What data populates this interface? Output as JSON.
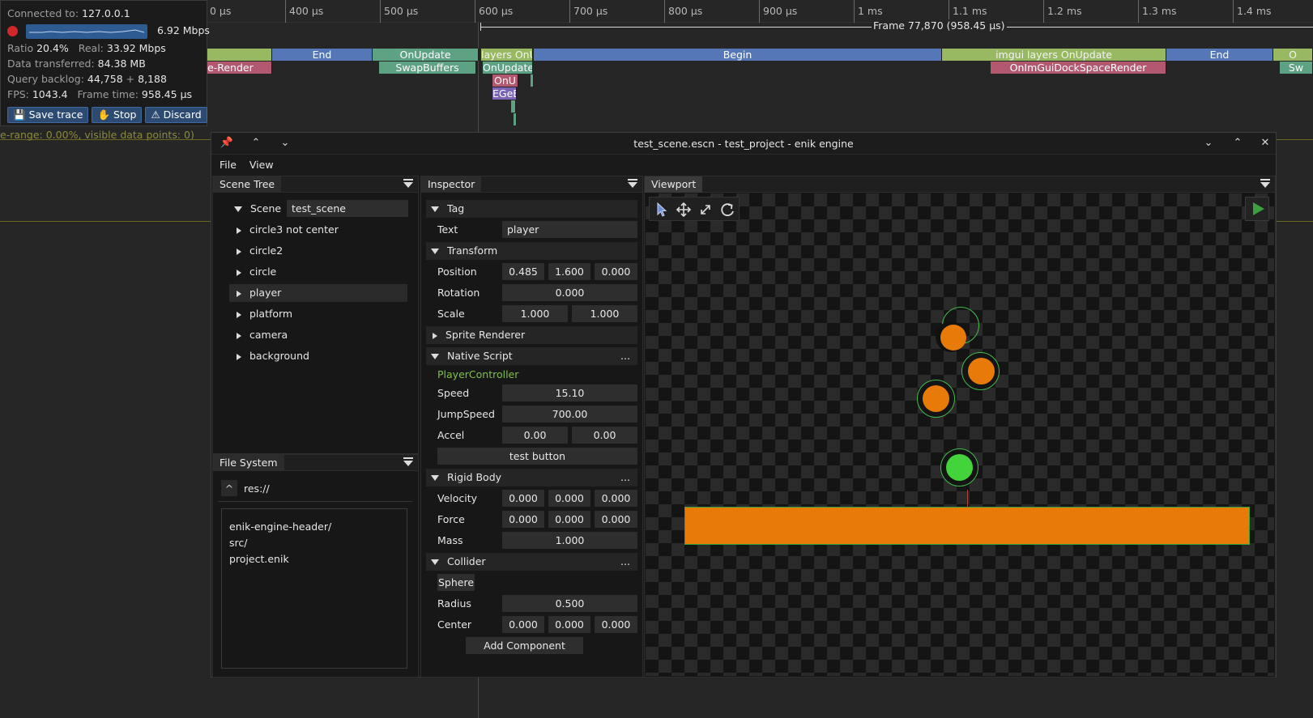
{
  "profiler": {
    "ticks": [
      "0 µs",
      "400 µs",
      "500 µs",
      "600 µs",
      "700 µs",
      "800 µs",
      "900 µs",
      "1 ms",
      "1.1 ms",
      "1.2 ms",
      "1.3 ms",
      "1.4 ms"
    ],
    "frame_label": "Frame 77,870 (958.45 µs)",
    "zones": {
      "end1": "End",
      "onupdate1": "OnUpdate",
      "render1": "e-Render",
      "swapbuffers": "SwapBuffers",
      "layers_onu": "layers OnU",
      "onupdate2": "OnUpdate",
      "begin": "Begin",
      "imgui_layers": "imgui layers OnUpdate",
      "end2": "End",
      "o_trunc": "O",
      "dockspace": "OnImGuiDockSpaceRender",
      "sw_trunc": "Sw",
      "onu_small": "OnU",
      "egeb": "EGeE",
      "update_trunc": "date",
      "dockspace_trunc": "OnImGuiDockSpace"
    },
    "range_text": "e-range: 0.00%, visible data points: 0)"
  },
  "connection": {
    "connected_label": "Connected to:",
    "address": "127.0.0.1",
    "bandwidth": "6.92 Mbps",
    "ratio_label": "Ratio",
    "ratio": "20.4%",
    "real_label": "Real:",
    "real": "33.92 Mbps",
    "data_label": "Data transferred:",
    "data": "84.38 MB",
    "backlog_label": "Query backlog:",
    "backlog_a": "44,758",
    "backlog_plus": "+",
    "backlog_b": "8,188",
    "fps_label": "FPS:",
    "fps": "1043.4",
    "frametime_label": "Frame time:",
    "frametime": "958.45 µs",
    "save_label": "Save trace",
    "stop_label": "Stop",
    "discard_label": "Discard"
  },
  "window": {
    "title": "test_scene.escn - test_project - enik engine",
    "menu": [
      "File",
      "View"
    ]
  },
  "scene_tree": {
    "tab": "Scene Tree",
    "root_label": "Scene",
    "scene_name": "test_scene",
    "items": [
      "circle3 not center",
      "circle2",
      "circle",
      "player",
      "platform",
      "camera",
      "background"
    ]
  },
  "file_system": {
    "tab": "File System",
    "up_label": "^",
    "path": "res://",
    "entries": [
      "enik-engine-header/",
      "src/",
      "project.enik"
    ]
  },
  "inspector": {
    "tab": "Inspector",
    "tag": {
      "header": "Tag",
      "text_label": "Text",
      "text_value": "player"
    },
    "transform": {
      "header": "Transform",
      "position_label": "Position",
      "position": [
        "0.485",
        "1.600",
        "0.000"
      ],
      "rotation_label": "Rotation",
      "rotation": "0.000",
      "scale_label": "Scale",
      "scale": [
        "1.000",
        "1.000"
      ]
    },
    "sprite_renderer": {
      "header": "Sprite Renderer"
    },
    "native_script": {
      "header": "Native Script",
      "dots": "...",
      "class_name": "PlayerController",
      "speed_label": "Speed",
      "speed": "15.10",
      "jump_label": "JumpSpeed",
      "jump": "700.00",
      "accel_label": "Accel",
      "accel": [
        "0.00",
        "0.00"
      ],
      "button_label": "test button"
    },
    "rigid_body": {
      "header": "Rigid Body",
      "dots": "...",
      "velocity_label": "Velocity",
      "velocity": [
        "0.000",
        "0.000",
        "0.000"
      ],
      "force_label": "Force",
      "force": [
        "0.000",
        "0.000",
        "0.000"
      ],
      "mass_label": "Mass",
      "mass": "1.000"
    },
    "collider": {
      "header": "Collider",
      "dots": "...",
      "shape": "Sphere",
      "radius_label": "Radius",
      "radius": "0.500",
      "center_label": "Center",
      "center": [
        "0.000",
        "0.000",
        "0.000"
      ]
    },
    "add_component": "Add Component"
  },
  "viewport": {
    "tab": "Viewport",
    "tools": [
      "select-icon",
      "move-icon",
      "scale-icon",
      "rotate-icon"
    ],
    "colors": {
      "orange": "#e87a0a",
      "green": "#43d33a",
      "outline": "#43b94e"
    }
  }
}
